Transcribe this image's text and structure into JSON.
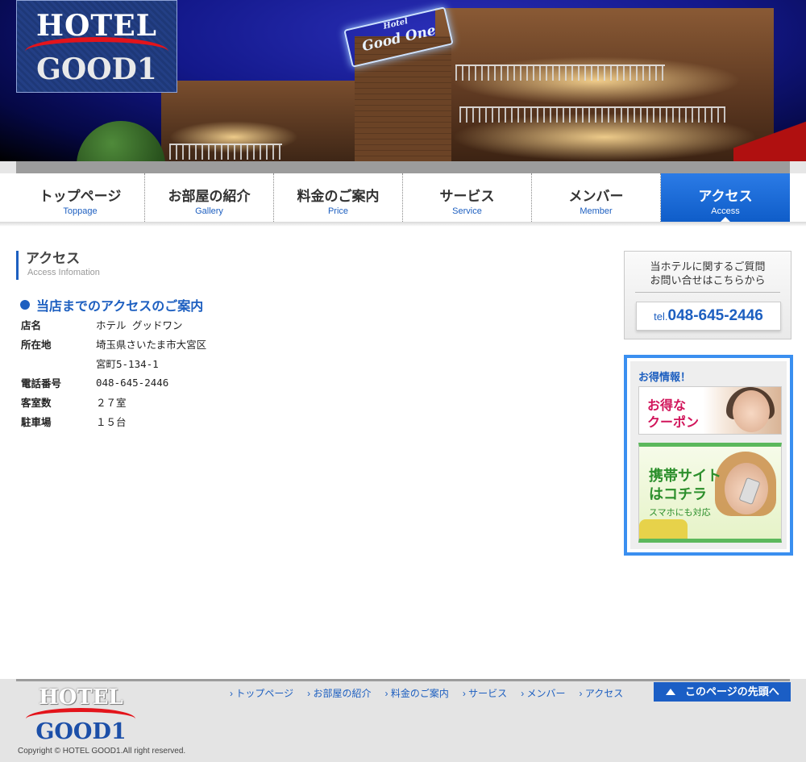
{
  "header": {
    "logo": {
      "line1": "HOTEL",
      "line2": "GOOD1"
    },
    "sign": {
      "line1": "Hotel",
      "line2": "Good One"
    }
  },
  "nav": {
    "items": [
      {
        "jp": "トップページ",
        "en": "Toppage"
      },
      {
        "jp": "お部屋の紹介",
        "en": "Gallery"
      },
      {
        "jp": "料金のご案内",
        "en": "Price"
      },
      {
        "jp": "サービス",
        "en": "Service"
      },
      {
        "jp": "メンバー",
        "en": "Member"
      },
      {
        "jp": "アクセス",
        "en": "Access"
      }
    ],
    "active": "アクセス"
  },
  "main": {
    "title": "アクセス",
    "subtitle": "Access Infomation",
    "section_title": "当店までのアクセスのご案内",
    "info": [
      {
        "key": "店名",
        "value": "ホテル グッドワン"
      },
      {
        "key": "所在地",
        "value": "埼玉県さいたま市大宮区"
      },
      {
        "key": "",
        "value": "宮町5-134-1"
      },
      {
        "key": "電話番号",
        "value": "048-645-2446"
      },
      {
        "key": "客室数",
        "value": "２７室"
      },
      {
        "key": "駐車場",
        "value": "１５台"
      }
    ]
  },
  "sidebar": {
    "contact": {
      "line1": "当ホテルに関するご質問",
      "line2": "お問い合せはこちらから",
      "tel_prefix": "tel.",
      "tel_number": "048-645-2446"
    },
    "promo": {
      "heading": "お得情報！",
      "coupon": {
        "line1": "お得な",
        "line2": "クーポン"
      },
      "mobile": {
        "line1": "携帯サイト",
        "line2": "はコチラ",
        "line3": "スマホにも対応"
      }
    }
  },
  "footer": {
    "logo": {
      "line1": "HOTEL",
      "line2": "GOOD1"
    },
    "links": [
      "トップページ",
      "お部屋の紹介",
      "料金のご案内",
      "サービス",
      "メンバー",
      "アクセス"
    ],
    "pagetop": "このページの先頭へ",
    "copyright": "Copyright © HOTEL GOOD1.All right reserved."
  },
  "colors": {
    "accent": "#1d5fc0",
    "nav_active": "#2b7be6",
    "logo_red": "#e3141b",
    "footer_bg": "#e4e4e4"
  }
}
